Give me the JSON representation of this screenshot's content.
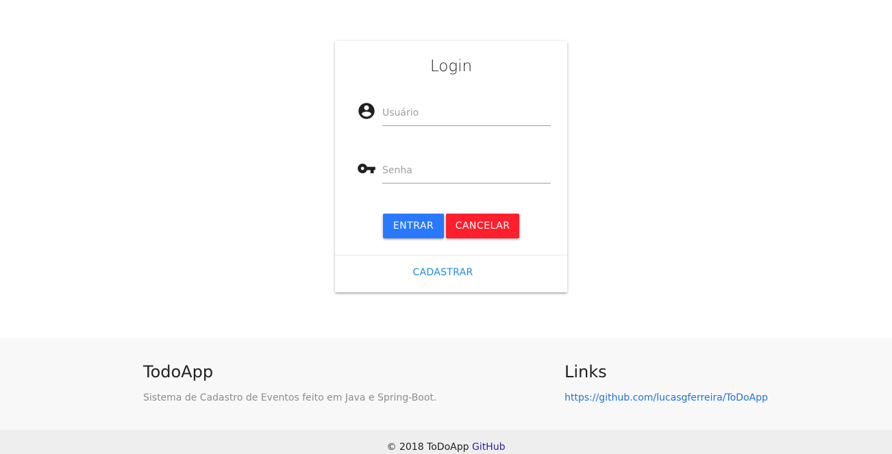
{
  "login": {
    "title": "Login",
    "username": {
      "placeholder": "Usuário",
      "value": "",
      "icon": "account-circle-icon"
    },
    "password": {
      "placeholder": "Senha",
      "value": "",
      "icon": "key-icon"
    },
    "enter_label": "ENTRAR",
    "cancel_label": "CANCELAR",
    "register_label": "CADASTRAR"
  },
  "footer": {
    "left_title": "TodoApp",
    "description": "Sistema de Cadastro de Eventos feito em Java e Spring-Boot.",
    "right_title": "Links",
    "link_text": "https://github.com/lucasgferreira/ToDoApp"
  },
  "copyright": {
    "text": "© 2018 ToDoApp",
    "link_label": "GitHub"
  },
  "colors": {
    "primary_button": "#2979ff",
    "cancel_button": "#ff1e2c",
    "link": "#1e88e5",
    "footer_bg": "#f8f8f8",
    "copyright_bg": "#eeeeee"
  }
}
